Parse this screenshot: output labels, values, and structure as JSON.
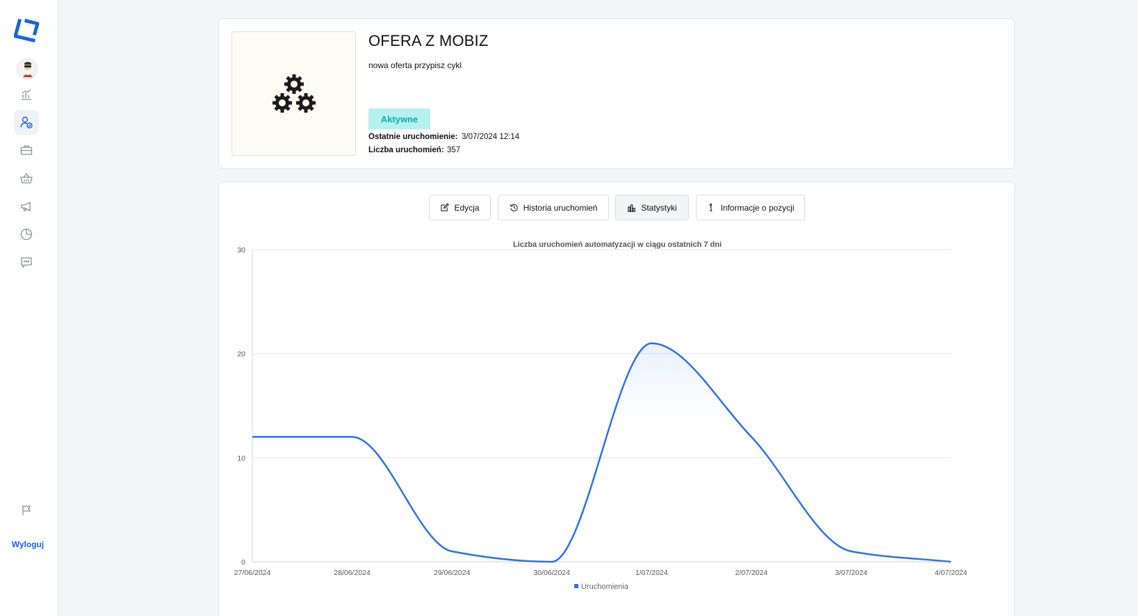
{
  "sidebar": {
    "logout_label": "Wyloguj",
    "accent": "#1a63d6"
  },
  "offer": {
    "title": "OFERA Z MOBIZ",
    "description": "nowa oferta przypisz cykl",
    "status": "Aktywne",
    "last_run_label": "Ostatnie uruchomienie:",
    "last_run_value": "3/07/2024 12:14",
    "run_count_label": "Liczba uruchomień:",
    "run_count_value": "357"
  },
  "tabs": [
    {
      "label": "Edycja",
      "icon": "edit-icon"
    },
    {
      "label": "Historia uruchomień",
      "icon": "history-icon"
    },
    {
      "label": "Statystyki",
      "icon": "bar-chart-icon",
      "active": true
    },
    {
      "label": "Informacje o pozycji",
      "icon": "info-icon"
    }
  ],
  "chart_data": {
    "type": "line",
    "title": "Liczba uruchomień automatyzacji w ciągu ostatnich 7 dni",
    "categories": [
      "27/06/2024",
      "28/06/2024",
      "29/06/2024",
      "30/06/2024",
      "1/07/2024",
      "2/07/2024",
      "3/07/2024",
      "4/07/2024"
    ],
    "series": [
      {
        "name": "Uruchomienia",
        "values": [
          12,
          12,
          1,
          0,
          21,
          12,
          1,
          0
        ],
        "color": "#2f6fe4"
      }
    ],
    "ylim": [
      0,
      30
    ],
    "yticks": [
      "0",
      "10",
      "20",
      "30"
    ],
    "grid": true,
    "legend": "bottom"
  }
}
